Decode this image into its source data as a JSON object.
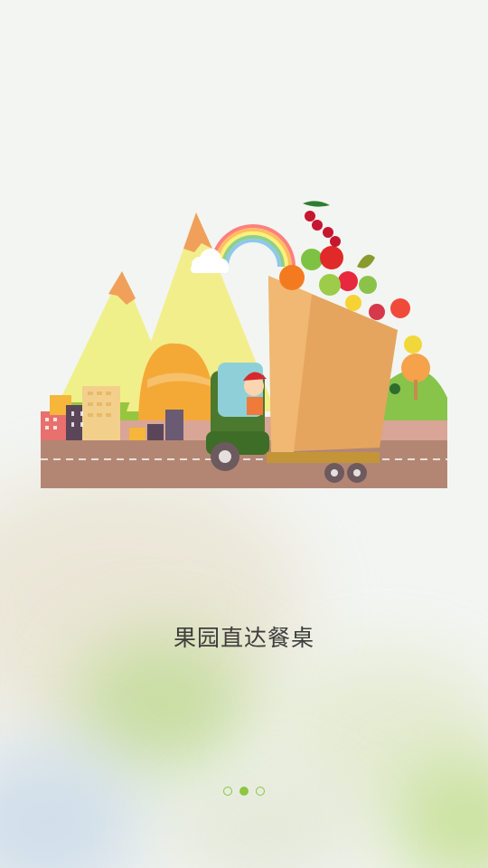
{
  "splash": {
    "tagline": "果园直达餐桌",
    "pager": {
      "count": 3,
      "active_index": 1
    },
    "accent_color": "#8dc63f"
  }
}
